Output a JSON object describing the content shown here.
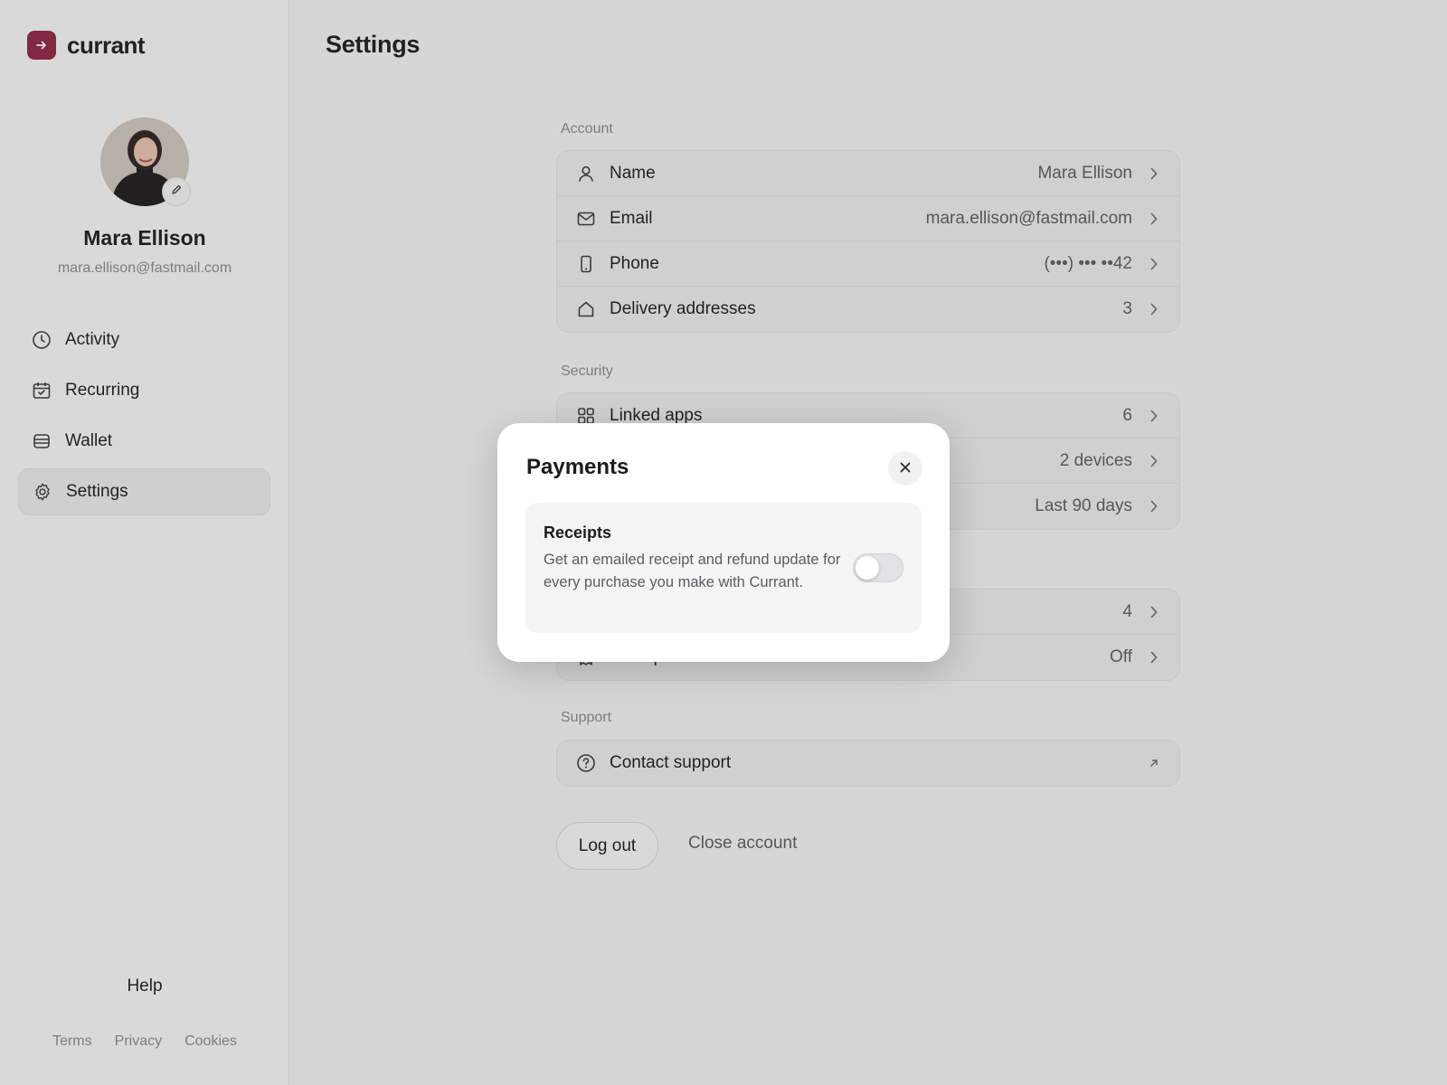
{
  "brand": {
    "name": "currant",
    "accent": "#8e2443"
  },
  "page": {
    "title": "Settings"
  },
  "profile": {
    "name": "Mara Ellison",
    "email": "mara.ellison@fastmail.com"
  },
  "nav": {
    "items": [
      {
        "label": "Activity",
        "icon": "clock-icon"
      },
      {
        "label": "Recurring",
        "icon": "calendar-check-icon"
      },
      {
        "label": "Wallet",
        "icon": "wallet-icon"
      },
      {
        "label": "Settings",
        "icon": "gear-icon",
        "active": true
      }
    ],
    "help": "Help",
    "footer": [
      "Terms",
      "Privacy",
      "Cookies"
    ]
  },
  "sections": {
    "account": {
      "label": "Account",
      "rows": [
        {
          "label": "Name",
          "value": "Mara Ellison",
          "icon": "person-icon"
        },
        {
          "label": "Email",
          "value": "mara.ellison@fastmail.com",
          "icon": "envelope-icon"
        },
        {
          "label": "Phone",
          "value": "(•••) ••• ••42",
          "icon": "phone-icon"
        },
        {
          "label": "Delivery addresses",
          "value": "3",
          "icon": "home-icon"
        }
      ]
    },
    "security": {
      "label": "Security",
      "rows": [
        {
          "label": "Linked apps",
          "value": "6",
          "icon": "grid-icon"
        },
        {
          "label": "",
          "value": "2 devices"
        },
        {
          "label": "",
          "value": "Last 90 days"
        }
      ]
    },
    "payments": {
      "rows": [
        {
          "label": "",
          "value": "4"
        },
        {
          "label": "Receipts",
          "value": "Off",
          "icon": "receipt-icon"
        }
      ]
    },
    "support": {
      "label": "Support",
      "rows": [
        {
          "label": "Contact support",
          "icon": "question-icon",
          "trailing": "arrow-up-right-icon"
        }
      ]
    }
  },
  "actions": {
    "logout": "Log out",
    "close_account": "Close account"
  },
  "modal": {
    "title": "Payments",
    "receipts": {
      "title": "Receipts",
      "description": "Get an emailed receipt and refund update for every purchase you make with Currant.",
      "enabled": false
    }
  }
}
